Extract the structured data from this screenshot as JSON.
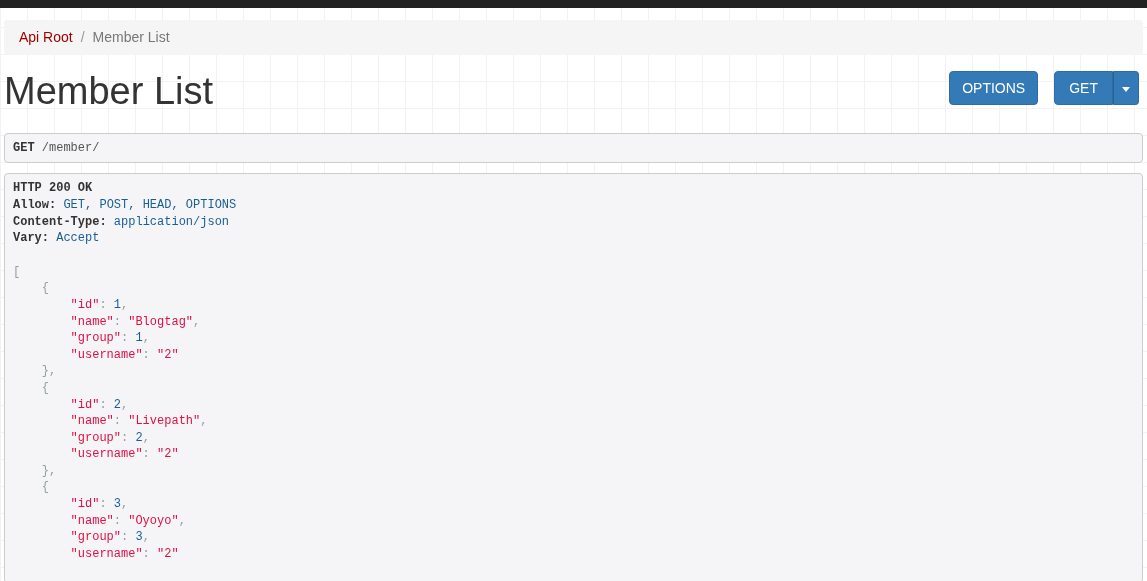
{
  "breadcrumb_separator": "/",
  "breadcrumb": [
    {
      "label": "Api Root",
      "selected": false
    },
    {
      "label": "Member List",
      "selected": true
    }
  ],
  "title": "Member List",
  "buttons": [
    {
      "label": "OPTIONS",
      "kind": "plain"
    },
    {
      "label": "GET",
      "kind": "split"
    }
  ],
  "request": {
    "method": "GET",
    "path": "/member/"
  },
  "response": {
    "status": "HTTP 200 OK",
    "headers": [
      {
        "name": "Allow:",
        "value": "GET, POST, HEAD, OPTIONS"
      },
      {
        "name": "Content-Type:",
        "value": "application/json"
      },
      {
        "name": "Vary:",
        "value": "Accept"
      }
    ],
    "body": {
      "open": "[",
      "objects": [
        {
          "open": "{",
          "close": "},",
          "fields": [
            {
              "key": "\"id\"",
              "colon": ":",
              "value": "1",
              "kind": "number",
              "comma": ","
            },
            {
              "key": "\"name\"",
              "colon": ":",
              "value": "\"Blogtag\"",
              "kind": "string",
              "comma": ","
            },
            {
              "key": "\"group\"",
              "colon": ":",
              "value": "1",
              "kind": "number",
              "comma": ","
            },
            {
              "key": "\"username\"",
              "colon": ":",
              "value": "\"2\"",
              "kind": "string"
            }
          ]
        },
        {
          "open": "{",
          "close": "},",
          "fields": [
            {
              "key": "\"id\"",
              "colon": ":",
              "value": "2",
              "kind": "number",
              "comma": ","
            },
            {
              "key": "\"name\"",
              "colon": ":",
              "value": "\"Livepath\"",
              "kind": "string",
              "comma": ","
            },
            {
              "key": "\"group\"",
              "colon": ":",
              "value": "2",
              "kind": "number",
              "comma": ","
            },
            {
              "key": "\"username\"",
              "colon": ":",
              "value": "\"2\"",
              "kind": "string"
            }
          ]
        },
        {
          "open": "{",
          "fields": [
            {
              "key": "\"id\"",
              "colon": ":",
              "value": "3",
              "kind": "number",
              "comma": ","
            },
            {
              "key": "\"name\"",
              "colon": ":",
              "value": "\"Oyoyo\"",
              "kind": "string",
              "comma": ","
            },
            {
              "key": "\"group\"",
              "colon": ":",
              "value": "3",
              "kind": "number",
              "comma": ","
            },
            {
              "key": "\"username\"",
              "colon": ":",
              "value": "\"2\"",
              "kind": "string"
            }
          ]
        }
      ]
    }
  }
}
